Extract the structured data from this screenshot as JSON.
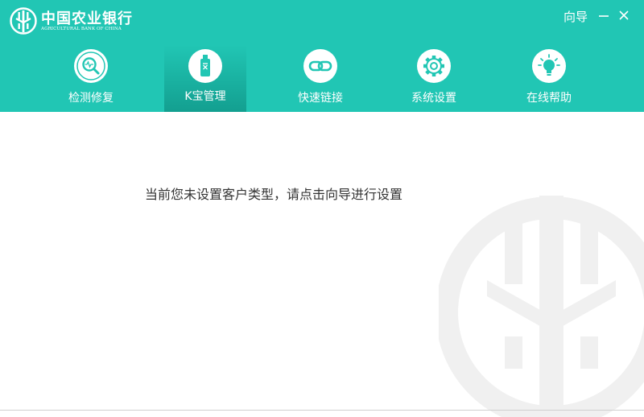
{
  "brand": {
    "name_cn": "中国农业银行",
    "name_en": "AGRICULTURAL BANK OF CHINA",
    "logo_icon": "abc-bank-logo-icon"
  },
  "titlebar": {
    "wizard_label": "向导",
    "minimize_icon": "minimize-icon",
    "close_icon": "close-icon"
  },
  "nav": {
    "tabs": [
      {
        "label": "检测修复",
        "icon": "diagnose-magnifier-icon",
        "active": false
      },
      {
        "label": "K宝管理",
        "icon": "usb-key-icon",
        "active": true
      },
      {
        "label": "快速链接",
        "icon": "link-icon",
        "active": false
      },
      {
        "label": "系统设置",
        "icon": "gear-icon",
        "active": false
      },
      {
        "label": "在线帮助",
        "icon": "lightbulb-icon",
        "active": false
      }
    ]
  },
  "main": {
    "message": "当前您未设置客户类型，请点击向导进行设置"
  },
  "colors": {
    "header_bg": "#21c6b4",
    "active_tab_bottom": "#139f90",
    "text": "#333333"
  }
}
